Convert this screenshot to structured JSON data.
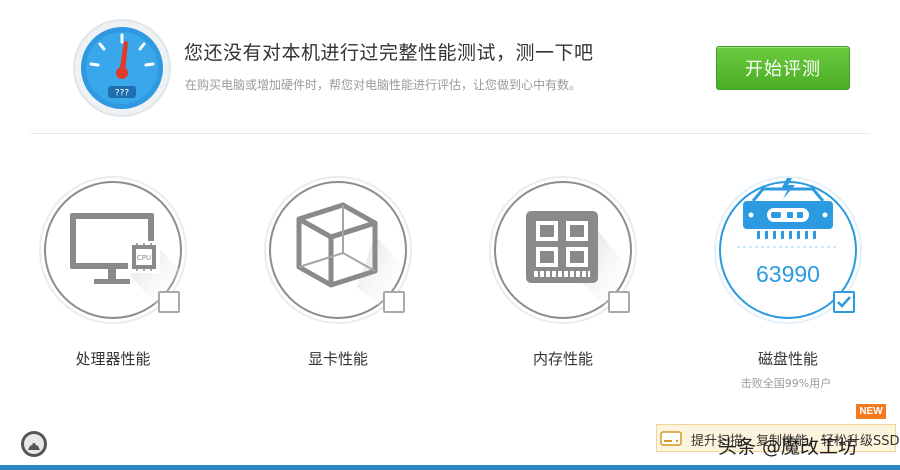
{
  "header": {
    "headline": "您还没有对本机进行过完整性能测试，测一下吧",
    "subline": "在购买电脑或增加硬件时，帮您对电脑性能进行评估，让您做到心中有数。",
    "gauge_readout": "???",
    "start_button": "开始评测"
  },
  "tests": [
    {
      "label": "处理器性能",
      "icon": "cpu-monitor-icon",
      "checked": false,
      "chip_text": "CPU"
    },
    {
      "label": "显卡性能",
      "icon": "cube-icon",
      "checked": false
    },
    {
      "label": "内存性能",
      "icon": "memory-chip-icon",
      "checked": false
    },
    {
      "label": "磁盘性能",
      "icon": "ssd-icon",
      "checked": true,
      "score": "63990",
      "rank_text": "击败全国99%用户"
    }
  ],
  "footer": {
    "promo_text": "提升扫描、复制性能，轻松升级SSD",
    "new_badge": "NEW",
    "watermark": "头条 @魔改工坊"
  },
  "colors": {
    "accent": "#2b9ae0",
    "button_green": "#5cbf32",
    "icon_gray": "#8a8a8a",
    "badge_orange": "#f47a20"
  }
}
